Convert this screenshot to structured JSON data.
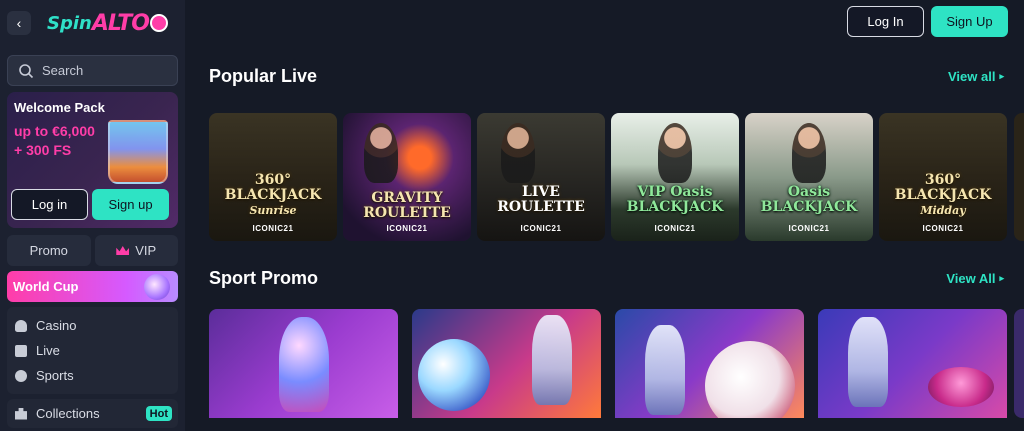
{
  "brand": {
    "logo_spin": "Spin",
    "logo_alto": "ALTO"
  },
  "sidebar": {
    "search_placeholder": "Search",
    "welcome": {
      "title": "Welcome Pack",
      "offer_line1": "up to €6,000",
      "offer_line2": "+ 300 FS",
      "login_label": "Log in",
      "signup_label": "Sign up"
    },
    "promo_label": "Promo",
    "vip_label": "VIP",
    "worldcup_label": "World Cup",
    "menu": [
      {
        "label": "Casino",
        "icon": "casino-icon"
      },
      {
        "label": "Live",
        "icon": "dice-icon"
      },
      {
        "label": "Sports",
        "icon": "sports-icon"
      }
    ],
    "collections_label": "Collections",
    "collections_badge": "Hot"
  },
  "header": {
    "login_label": "Log In",
    "signup_label": "Sign Up"
  },
  "sections": {
    "popular_live": {
      "title": "Popular Live",
      "view_all": "View all",
      "games": [
        {
          "name": "360° BLACKJACK",
          "sub": "Sunrise",
          "provider": "ICONIC21"
        },
        {
          "name": "GRAVITY ROULETTE",
          "sub": "",
          "provider": "ICONIC21"
        },
        {
          "name": "LIVE ROULETTE",
          "sub": "",
          "provider": "ICONIC21"
        },
        {
          "name": "VIP Oasis BLACKJACK",
          "sub": "",
          "provider": "ICONIC21"
        },
        {
          "name": "Oasis BLACKJACK",
          "sub": "",
          "provider": "ICONIC21"
        },
        {
          "name": "360° BLACKJACK",
          "sub": "Midday",
          "provider": "ICONIC21"
        }
      ]
    },
    "sport_promo": {
      "title": "Sport Promo",
      "view_all": "View All"
    }
  },
  "colors": {
    "accent": "#2ee3c4",
    "brand_pink": "#ff3da8",
    "background": "#151a26",
    "sidebar": "#1c2130"
  }
}
